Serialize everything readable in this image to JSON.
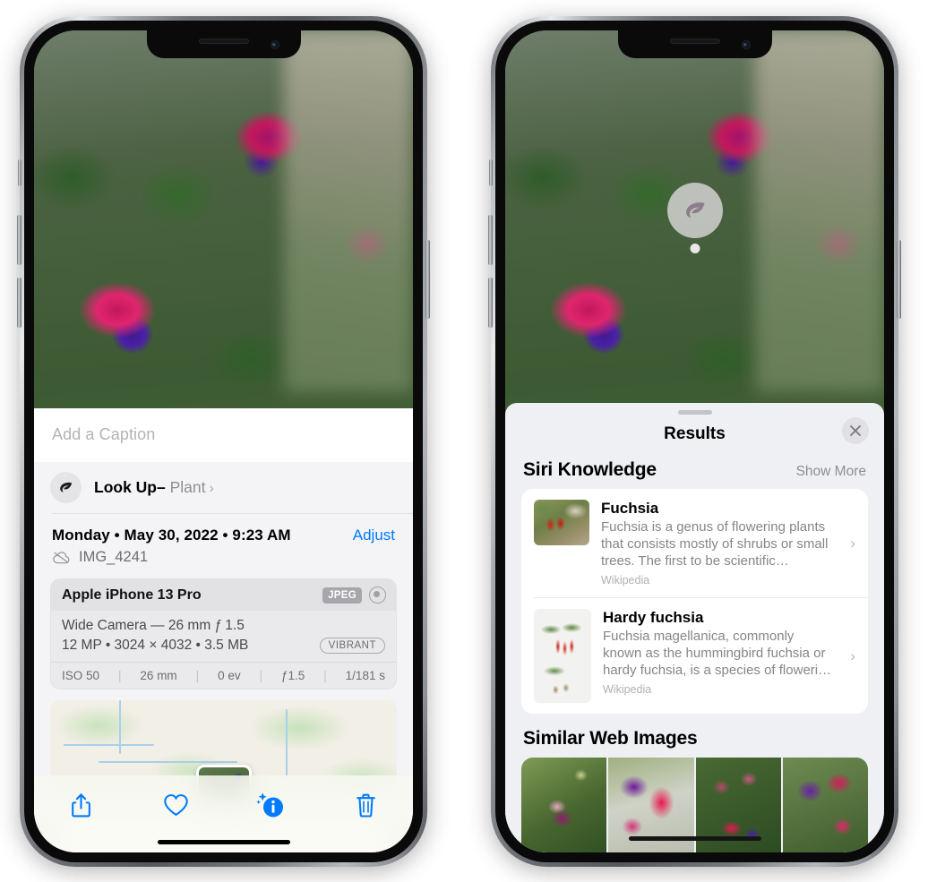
{
  "left_phone": {
    "caption_placeholder": "Add a Caption",
    "lookup": {
      "label": "Look Up",
      "dash": "–",
      "subject": "Plant",
      "chevron": "›",
      "icon": "leaf-icon"
    },
    "meta": {
      "date": "Monday • May 30, 2022 • 9:23 AM",
      "adjust_label": "Adjust",
      "filename": "IMG_4241",
      "cloud_icon": "cloud-slash-icon"
    },
    "exif": {
      "model": "Apple iPhone 13 Pro",
      "format_badge": "JPEG",
      "lens_icon": "lens-ring-icon",
      "lens_line": "Wide Camera — 26 mm ƒ 1.5",
      "size_line": "12 MP • 3024 × 4032 • 3.5 MB",
      "style_badge": "VIBRANT",
      "stats": [
        "ISO 50",
        "26 mm",
        "0 ev",
        "ƒ1.5",
        "1/181 s"
      ]
    },
    "toolbar": [
      {
        "name": "share-button",
        "icon": "share-icon"
      },
      {
        "name": "favorite-button",
        "icon": "heart-icon"
      },
      {
        "name": "info-button",
        "icon": "info-sparkle-icon"
      },
      {
        "name": "delete-button",
        "icon": "trash-icon"
      }
    ]
  },
  "right_phone": {
    "visual_lookup_badge": "leaf-icon",
    "results": {
      "title": "Results",
      "close_icon": "close-icon"
    },
    "siri_knowledge": {
      "heading": "Siri Knowledge",
      "action": "Show More",
      "items": [
        {
          "title": "Fuchsia",
          "description": "Fuchsia is a genus of flowering plants that consists mostly of shrubs or small trees. The first to be scientific…",
          "source": "Wikipedia",
          "chevron": "›"
        },
        {
          "title": "Hardy fuchsia",
          "description": "Fuchsia magellanica, commonly known as the hummingbird fuchsia or hardy fuchsia, is a species of floweri…",
          "source": "Wikipedia",
          "chevron": "›"
        }
      ]
    },
    "similar_web_images": {
      "heading": "Similar Web Images",
      "count": 4
    }
  },
  "colors": {
    "accent_blue": "#007aff",
    "sheet_bg": "#f4f4f6",
    "results_bg": "#eff0f4",
    "card_white": "#ffffff",
    "secondary_text": "#8e8e93"
  }
}
